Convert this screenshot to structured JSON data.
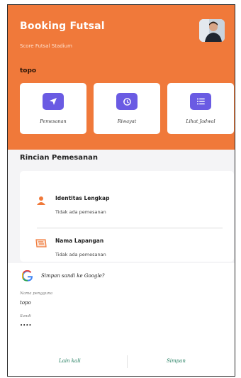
{
  "header": {
    "title": "Booking Futsal",
    "subtitle": "Score Futsal Stadium",
    "username": "topo",
    "avatar_icon": "user-avatar-photo"
  },
  "menu": [
    {
      "label": "Pemesanan",
      "icon": "send-icon"
    },
    {
      "label": "Riwayat",
      "icon": "history-icon"
    },
    {
      "label": "Lihat Jadwal",
      "icon": "list-icon"
    }
  ],
  "details": {
    "title": "Rincian Pemesanan",
    "rows": [
      {
        "title": "Identitas Lengkap",
        "value": "Tidak ada pemesanan",
        "icon": "person-icon"
      },
      {
        "title": "Nama Lapangan",
        "value": "Tidak ada pemesanan",
        "icon": "field-icon"
      }
    ]
  },
  "google_prompt": {
    "title": "Simpan sandi ke Google?",
    "username_label": "Nama pengguna",
    "username_value": "topo",
    "password_label": "Sandi",
    "password_value": "••••",
    "cancel_label": "Lain kali",
    "save_label": "Simpan"
  },
  "colors": {
    "header": "#f0793a",
    "menu_icon": "#6a5be3",
    "button_text": "#1c7a5b"
  }
}
